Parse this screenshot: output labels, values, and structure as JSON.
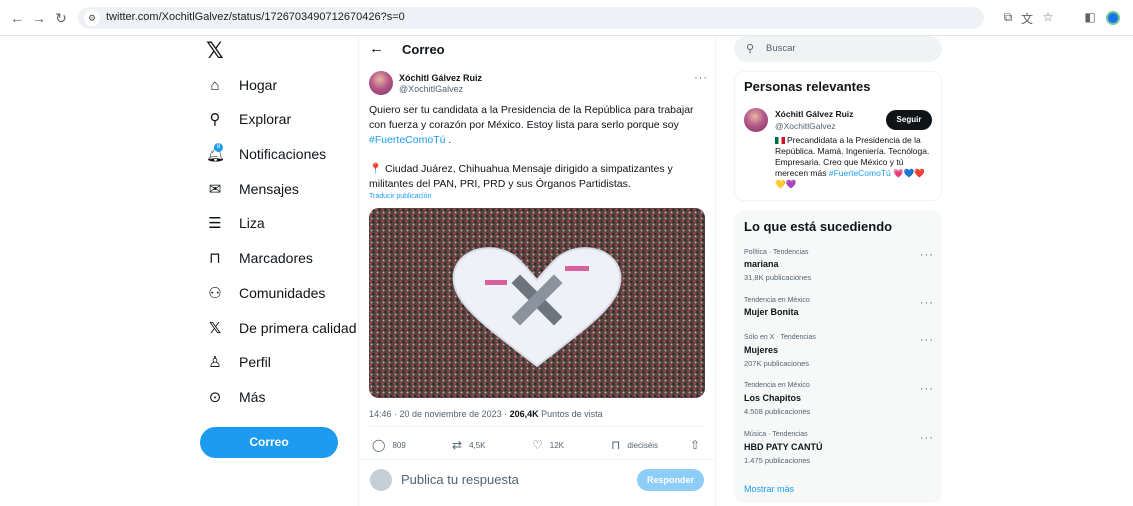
{
  "browser": {
    "url": "twitter.com/XochitlGalvez/status/1726703490712670426?s=0"
  },
  "sidebar": {
    "items": [
      {
        "label": "Hogar",
        "icon": "home-icon"
      },
      {
        "label": "Explorar",
        "icon": "search-icon"
      },
      {
        "label": "Notificaciones",
        "icon": "bell-icon"
      },
      {
        "label": "Mensajes",
        "icon": "mail-icon"
      },
      {
        "label": "Liza",
        "icon": "list-icon"
      },
      {
        "label": "Marcadores",
        "icon": "bookmark-icon"
      },
      {
        "label": "Comunidades",
        "icon": "communities-icon"
      },
      {
        "label": "De primera calidad",
        "icon": "x-logo-icon"
      },
      {
        "label": "Perfil",
        "icon": "person-icon"
      },
      {
        "label": "Más",
        "icon": "more-circle-icon"
      }
    ],
    "post_button": "Correo",
    "notification_badge": "8"
  },
  "main": {
    "header_title": "Correo",
    "tweet": {
      "author_name": "Xóchitl Gálvez Ruiz",
      "author_handle": "@XochitlGalvez",
      "text_1": "Quiero ser tu candidata a la Presidencia de la República para trabajar con fuerza y corazón por México. Estoy lista para serlo porque soy",
      "hashtag": "#FuerteComoTú",
      "text_1_end": " .",
      "text_2": "📍 Ciudad Juárez, Chihuahua Mensaje dirigido a simpatizantes y militantes del PAN, PRI, PRD y sus Órganos Partidistas.",
      "translate": "Traducir publicación",
      "timestamp": "14:46 · 20 de noviembre de 2023 · ",
      "views_count": "206,4K",
      "views_label": " Puntos de vista",
      "actions": {
        "replies": "809",
        "reposts": "4,5K",
        "likes": "12K",
        "bookmarks": "dieciséis"
      }
    },
    "reply_box": {
      "placeholder": "Publica tu respuesta",
      "button": "Responder"
    }
  },
  "right": {
    "search_placeholder": "Buscar",
    "relevant": {
      "title": "Personas relevantes",
      "name": "Xóchitl Gálvez Ruiz",
      "handle": "@XochitlGalvez",
      "follow": "Seguir",
      "bio": "Precandidata a la Presidencia de la República. Mamá. Ingeniería. Tecnóloga. Empresaria. Creo que México y tú merecen más",
      "bio_hashtag": "#FuerteComoTú",
      "bio_hearts": "💗💙❤️💛💜"
    },
    "trends": {
      "title": "Lo que está sucediendo",
      "items": [
        {
          "context": "Política · Tendencias",
          "name": "mariana",
          "count": "31,8K publicaciones"
        },
        {
          "context": "Tendencia en México",
          "name": "Mujer Bonita",
          "count": ""
        },
        {
          "context": "Sólo en X · Tendencias",
          "name": "Mujeres",
          "count": "207K publicaciones"
        },
        {
          "context": "Tendencia en México",
          "name": "Los Chapitos",
          "count": "4.508 publicaciones"
        },
        {
          "context": "Música · Tendencias",
          "name": "HBD PATY CANTÚ",
          "count": "1.475 publicaciones"
        }
      ],
      "show_more": "Mostrar más"
    }
  },
  "colors": {
    "accent": "#1d9bf0",
    "text": "#0f1419",
    "muted": "#536471"
  }
}
